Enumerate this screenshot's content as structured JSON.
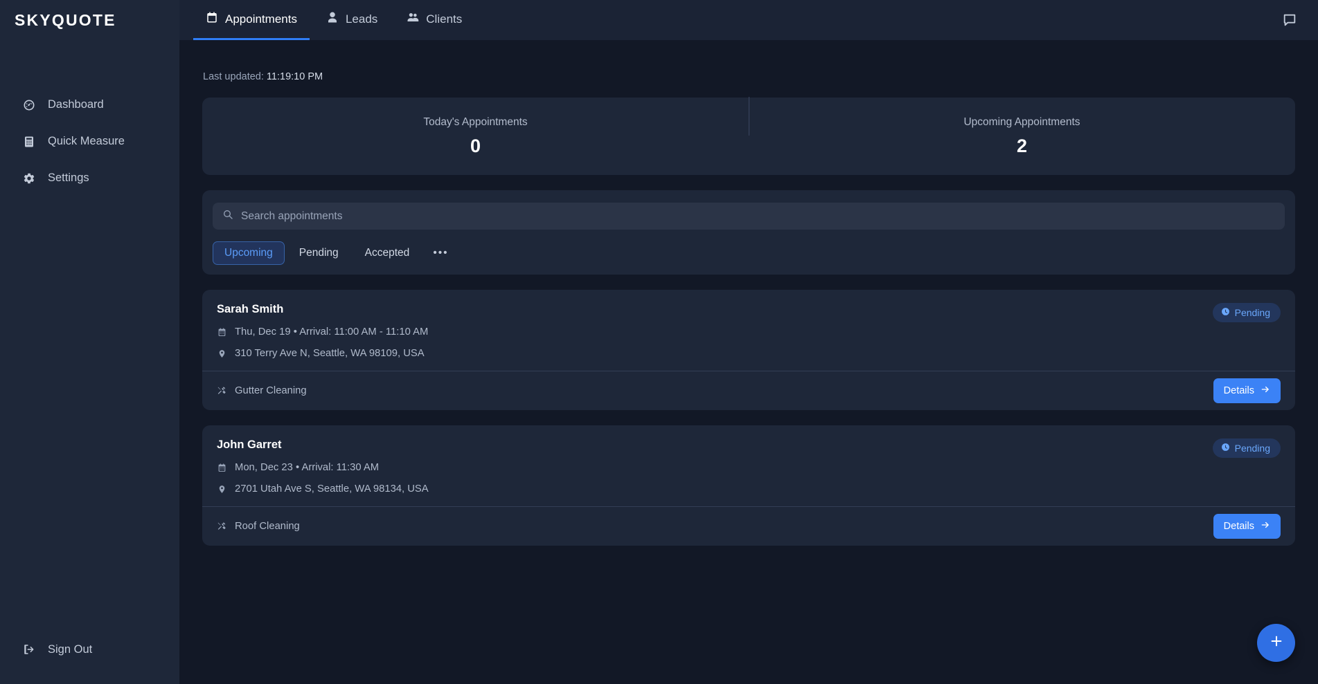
{
  "brand": {
    "name": "SKYQUOTE"
  },
  "sidebar": {
    "items": [
      {
        "label": "Dashboard",
        "icon": "gauge-icon"
      },
      {
        "label": "Quick Measure",
        "icon": "calculator-icon"
      },
      {
        "label": "Settings",
        "icon": "gear-icon"
      }
    ],
    "sign_out": {
      "label": "Sign Out",
      "icon": "logout-icon"
    }
  },
  "topbar": {
    "tabs": [
      {
        "label": "Appointments",
        "icon": "calendar-icon",
        "active": true
      },
      {
        "label": "Leads",
        "icon": "person-icon",
        "active": false
      },
      {
        "label": "Clients",
        "icon": "people-icon",
        "active": false
      }
    ],
    "messages_icon": "message-bubble-icon"
  },
  "status": {
    "last_updated_label": "Last updated:",
    "last_updated_time": "11:19:10 PM"
  },
  "stats": [
    {
      "label": "Today's Appointments",
      "value": "0"
    },
    {
      "label": "Upcoming Appointments",
      "value": "2"
    }
  ],
  "search": {
    "placeholder": "Search appointments",
    "value": "",
    "icon": "search-icon"
  },
  "filters": [
    {
      "label": "Upcoming",
      "active": true
    },
    {
      "label": "Pending",
      "active": false
    },
    {
      "label": "Accepted",
      "active": false
    },
    {
      "label": "•••",
      "active": false
    }
  ],
  "appointments": [
    {
      "name": "Sarah Smith",
      "schedule": "Thu, Dec 19 • Arrival: 11:00 AM - 11:10 AM",
      "address": "310 Terry Ave N, Seattle, WA 98109, USA",
      "service": "Gutter Cleaning",
      "status": "Pending",
      "details_label": "Details"
    },
    {
      "name": "John Garret",
      "schedule": "Mon, Dec 23 • Arrival: 11:30 AM",
      "address": "2701 Utah Ave S, Seattle, WA 98134, USA",
      "service": "Roof Cleaning",
      "status": "Pending",
      "details_label": "Details"
    }
  ],
  "fab": {
    "icon": "plus-icon"
  },
  "colors": {
    "background": "#121826",
    "surface": "#1e2739",
    "accent": "#3b82f6",
    "accent_text": "#5b9cf8",
    "input": "#2b3447",
    "muted_text": "#9aa6ba"
  }
}
